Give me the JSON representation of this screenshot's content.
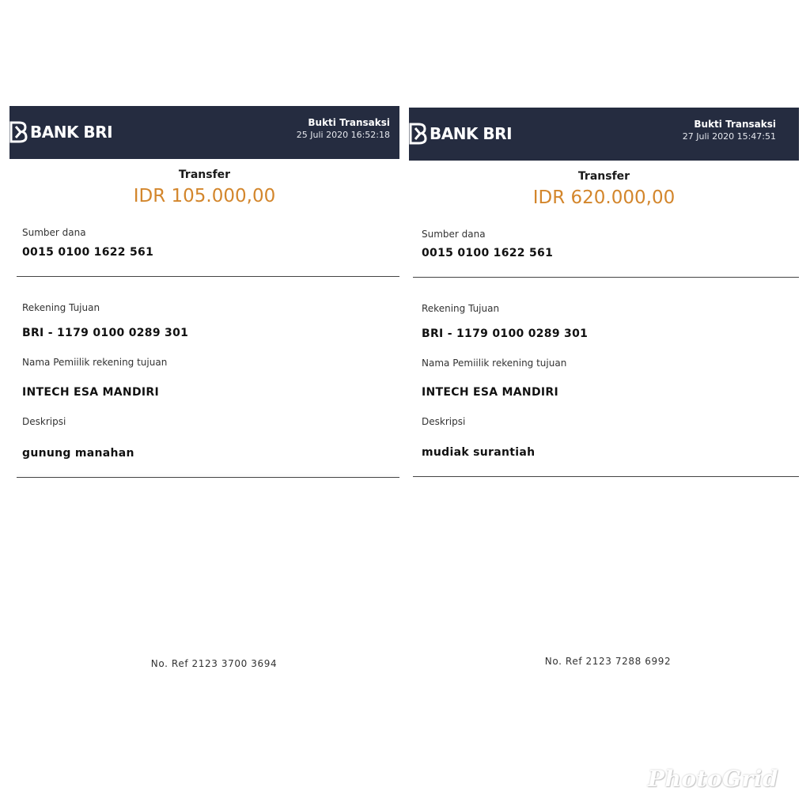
{
  "receipts": [
    {
      "bank_name": "BANK BRI",
      "header_title": "Bukti Transaksi",
      "header_datetime": "25 Juli 2020 16:52:18",
      "transaction_type": "Transfer",
      "amount": "IDR 105.000,00",
      "source_label": "Sumber dana",
      "source_account": "0015 0100 1622 561",
      "dest_label": "Rekening  Tujuan",
      "dest_account": "BRI - 1179 0100 0289 301",
      "owner_label": "Nama Pemiilik rekening tujuan",
      "owner_name": "INTECH  ESA MANDIRI",
      "desc_label": "Deskripsi",
      "description": "gunung  manahan",
      "ref": "No. Ref  2123  3700  3694"
    },
    {
      "bank_name": "BANK BRI",
      "header_title": "Bukti Transaksi",
      "header_datetime": "27 Juli 2020 15:47:51",
      "transaction_type": "Transfer",
      "amount": "IDR 620.000,00",
      "source_label": "Sumber dana",
      "source_account": "0015 0100 1622 561",
      "dest_label": "Rekening  Tujuan",
      "dest_account": "BRI - 1179 0100 0289 301",
      "owner_label": "Nama Pemiilik rekening tujuan",
      "owner_name": "INTECH  ESA MANDIRI",
      "desc_label": "Deskripsi",
      "description": "mudiak  surantiah",
      "ref": "No. Ref  2123  7288  6992"
    }
  ],
  "watermark": "PhotoGrid",
  "colors": {
    "header_bg": "#252c40",
    "amount": "#d3862c"
  },
  "icons": {
    "logo": "bri-logo-icon"
  }
}
